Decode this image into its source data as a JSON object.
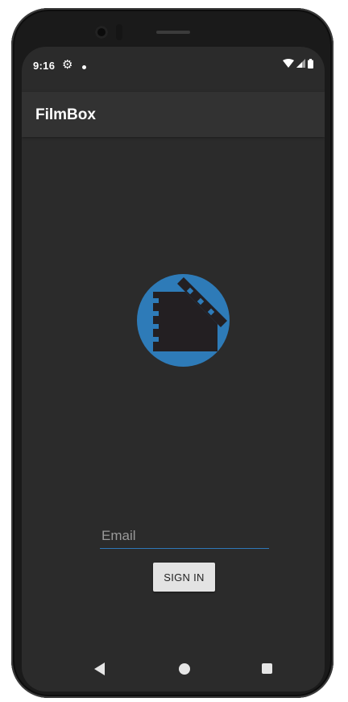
{
  "status_bar": {
    "time": "9:16",
    "left_icons": [
      "gear-icon",
      "notification-dot-icon"
    ],
    "right_icons": [
      "wifi-icon",
      "cell-signal-icon",
      "battery-icon"
    ]
  },
  "app_bar": {
    "title": "FilmBox"
  },
  "logo": {
    "icon": "film-clapper-icon",
    "circle_color": "#2e7bb8",
    "film_color": "#231f22"
  },
  "login": {
    "email_placeholder": "Email",
    "email_value": "",
    "signin_label": "SIGN IN"
  },
  "nav_bar": {
    "icons": [
      "back-icon",
      "home-icon",
      "recents-icon"
    ]
  },
  "colors": {
    "screen_bg": "#2b2b2b",
    "app_bar_bg": "#323232",
    "accent": "#2f78b8"
  }
}
